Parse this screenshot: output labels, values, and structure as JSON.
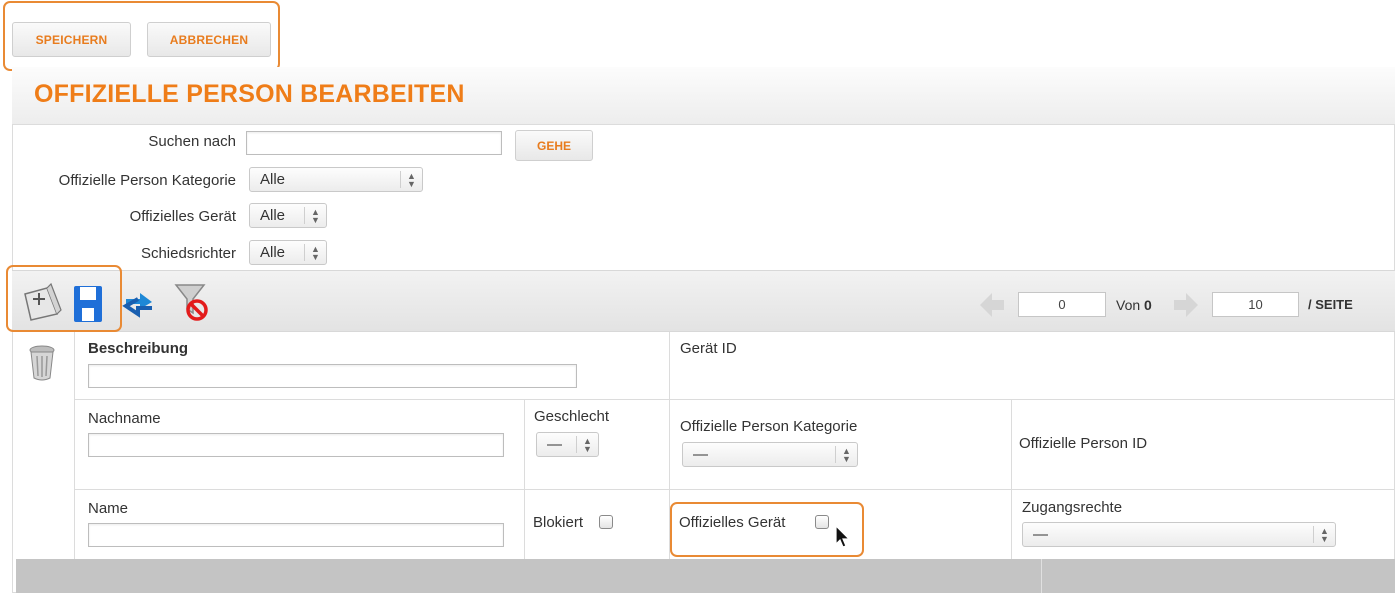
{
  "top_buttons": {
    "save": "SPEICHERN",
    "cancel": "ABBRECHEN"
  },
  "page_title": "OFFIZIELLE PERSON BEARBEITEN",
  "filters": {
    "search_label": "Suchen nach",
    "search_value": "",
    "go_label": "GEHE",
    "category_label": "Offizielle Person Kategorie",
    "category_value": "Alle",
    "device_label": "Offizielles Gerät",
    "device_value": "Alle",
    "referee_label": "Schiedsrichter",
    "referee_value": "Alle"
  },
  "toolbar": {
    "icons": [
      "new-record-icon",
      "save-disk-icon",
      "refresh-icon",
      "clear-filter-icon"
    ],
    "pager": {
      "start_value": "0",
      "of_label": "Von",
      "total": "0",
      "per_page_value": "10",
      "per_page_label": "/ SEITE"
    }
  },
  "form": {
    "description_label": "Beschreibung",
    "device_id_label": "Gerät ID",
    "lastname_label": "Nachname",
    "gender_label": "Geschlecht",
    "gender_value": "—",
    "category_label": "Offizielle Person Kategorie",
    "category_value": "—",
    "person_id_label": "Offizielle Person ID",
    "name_label": "Name",
    "blocked_label": "Blokiert",
    "device_label": "Offizielles Gerät",
    "access_label": "Zugangsrechte",
    "access_value": "—"
  },
  "colors": {
    "accent": "#ef7d18",
    "highlight": "#e98a34",
    "save_icon": "#1f6fd8"
  }
}
